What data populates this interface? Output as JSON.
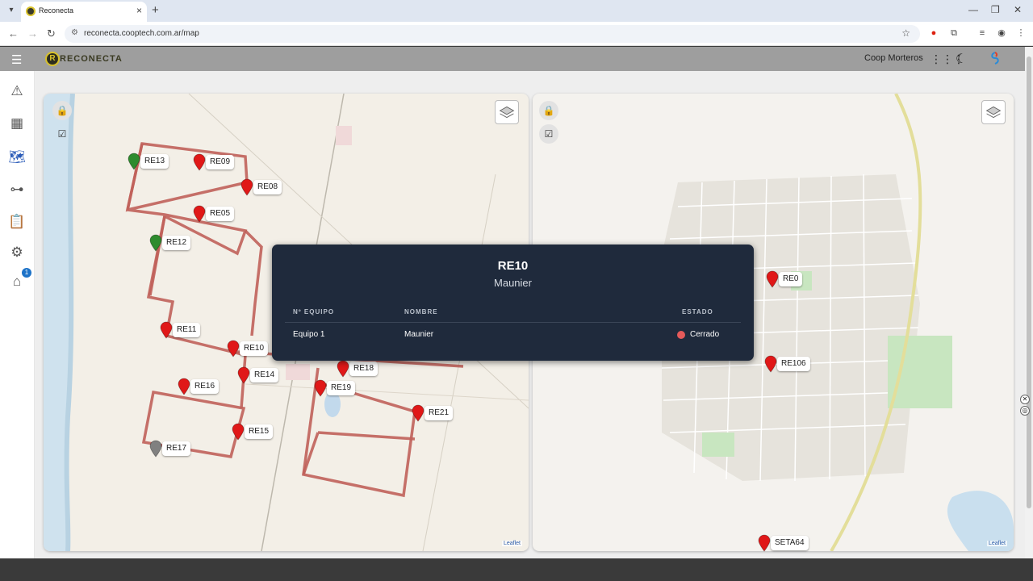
{
  "browser": {
    "tab_title": "Reconecta",
    "url": "reconecta.cooptech.com.ar/map"
  },
  "header": {
    "logo_text": "RECONECTA",
    "organization": "Coop Morteros"
  },
  "sidebar": {
    "alerts_badge": "1"
  },
  "map_left": {
    "attribution": "Leaflet",
    "markers": [
      {
        "label": "RE13",
        "color": "#2e8b2e"
      },
      {
        "label": "RE09",
        "color": "#e01818"
      },
      {
        "label": "RE08",
        "color": "#e01818"
      },
      {
        "label": "RE05",
        "color": "#e01818"
      },
      {
        "label": "RE12",
        "color": "#2e8b2e"
      },
      {
        "label": "RE11",
        "color": "#e01818"
      },
      {
        "label": "RE10",
        "color": "#e01818"
      },
      {
        "label": "RE14",
        "color": "#e01818"
      },
      {
        "label": "RE16",
        "color": "#e01818"
      },
      {
        "label": "RE18",
        "color": "#e01818"
      },
      {
        "label": "RE19",
        "color": "#e01818"
      },
      {
        "label": "RE21",
        "color": "#e01818"
      },
      {
        "label": "RE15",
        "color": "#e01818"
      },
      {
        "label": "RE17",
        "color": "#808080"
      }
    ]
  },
  "map_right": {
    "attribution": "Leaflet",
    "markers": [
      {
        "label": "RE0",
        "color": "#e01818"
      },
      {
        "label": "RE106",
        "color": "#e01818"
      },
      {
        "label": "SETA64",
        "color": "#e01818"
      }
    ]
  },
  "popup": {
    "title": "RE10",
    "subtitle": "Maunier",
    "columns": {
      "equipo": "Nº EQUIPO",
      "nombre": "NOMBRE",
      "estado": "ESTADO"
    },
    "row": {
      "equipo": "Equipo 1",
      "nombre": "Maunier",
      "estado": "Cerrado",
      "estado_color": "#e45a5a"
    }
  }
}
